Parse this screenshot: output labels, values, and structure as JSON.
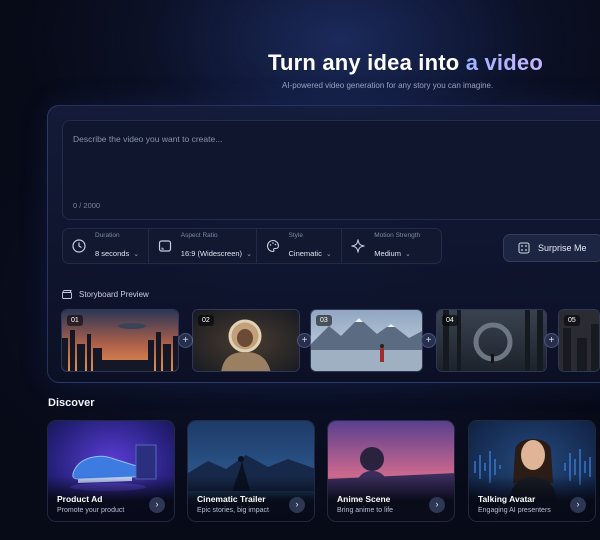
{
  "hero": {
    "title_main": "Turn any idea into",
    "title_accent": "a video",
    "subtitle": "AI-powered video generation for any story you can imagine."
  },
  "prompt": {
    "placeholder": "Describe the video you want to create...",
    "char_count": "0 / 2000"
  },
  "settings": [
    {
      "label": "Duration",
      "value": "8 seconds",
      "icon": "clock-icon"
    },
    {
      "label": "Aspect Ratio",
      "value": "16:9 (Widescreen)",
      "icon": "aspect-ratio-icon"
    },
    {
      "label": "Style",
      "value": "Cinematic",
      "icon": "palette-icon"
    },
    {
      "label": "Motion Strength",
      "value": "Medium",
      "icon": "sparkle-icon"
    }
  ],
  "surprise_button": {
    "label": "Surprise Me",
    "icon": "dice-icon"
  },
  "storyboard": {
    "title": "Storyboard Preview",
    "icon": "clapperboard-icon",
    "frames": [
      {
        "number": "01"
      },
      {
        "number": "02"
      },
      {
        "number": "03"
      },
      {
        "number": "04"
      },
      {
        "number": "05"
      }
    ],
    "add_symbol": "+"
  },
  "discover": {
    "title": "Discover",
    "cards": [
      {
        "title": "Product Ad",
        "subtitle": "Promote your product"
      },
      {
        "title": "Cinematic Trailer",
        "subtitle": "Epic stories, big impact"
      },
      {
        "title": "Anime Scene",
        "subtitle": "Bring anime to life"
      },
      {
        "title": "Talking Avatar",
        "subtitle": "Engaging AI presenters"
      }
    ],
    "arrow_symbol": "›"
  },
  "colors": {
    "accent": "#a9b8ff",
    "background": "#060914",
    "panel": "#141c3a"
  }
}
